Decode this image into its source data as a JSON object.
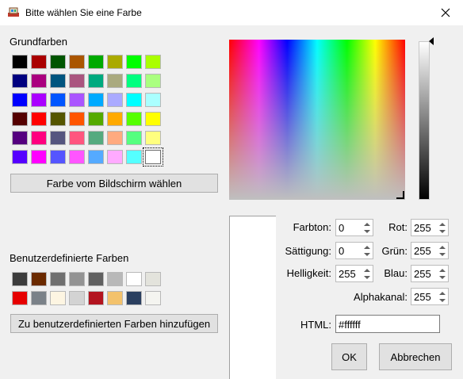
{
  "window": {
    "title": "Bitte wählen Sie eine Farbe"
  },
  "basic_colors": {
    "label": "Grundfarben",
    "rows": [
      [
        "#000000",
        "#aa0000",
        "#005500",
        "#aa5500",
        "#00aa00",
        "#aaaa00",
        "#00ff00",
        "#aaff00"
      ],
      [
        "#00007f",
        "#aa007f",
        "#00557f",
        "#aa557f",
        "#00aa7f",
        "#aaaa7f",
        "#00ff7f",
        "#aaff7f"
      ],
      [
        "#0000ff",
        "#aa00ff",
        "#0055ff",
        "#aa55ff",
        "#00aaff",
        "#aaaaff",
        "#00ffff",
        "#aaffff"
      ],
      [
        "#550000",
        "#ff0000",
        "#555500",
        "#ff5500",
        "#55aa00",
        "#ffaa00",
        "#55ff00",
        "#ffff00"
      ],
      [
        "#55007f",
        "#ff007f",
        "#55557f",
        "#ff557f",
        "#55aa7f",
        "#ffaa7f",
        "#55ff7f",
        "#ffff7f"
      ],
      [
        "#5500ff",
        "#ff00ff",
        "#5555ff",
        "#ff55ff",
        "#55aaff",
        "#ffaaff",
        "#55ffff",
        "#ffffff"
      ]
    ]
  },
  "pick_screen_button": "Farbe vom Bildschirm wählen",
  "custom_colors": {
    "label": "Benutzerdefinierte Farben",
    "rows": [
      [
        "#3c3c3c",
        "#6b2a00",
        "#6f6f6f",
        "#939393",
        "#606060",
        "#b8b8b8",
        "#ffffff",
        "#e3e3dc"
      ],
      [
        "#e60000",
        "#7a8188",
        "#fdf5e2",
        "#d3d3d3",
        "#b3141f",
        "#f3c26c",
        "#2a3f5f",
        "#f4f4f0"
      ]
    ]
  },
  "add_custom_button": "Zu benutzerdefinierten Farben hinzufügen",
  "fields": {
    "hue": {
      "label": "Farbton:",
      "value": "0"
    },
    "saturation": {
      "label": "Sättigung:",
      "value": "0"
    },
    "value": {
      "label": "Helligkeit:",
      "value": "255"
    },
    "red": {
      "label": "Rot:",
      "value": "255"
    },
    "green": {
      "label": "Grün:",
      "value": "255"
    },
    "blue": {
      "label": "Blau:",
      "value": "255"
    },
    "alpha": {
      "label": "Alphakanal:",
      "value": "255"
    },
    "html": {
      "label": "HTML:",
      "value": "#ffffff"
    }
  },
  "current_color": "#ffffff",
  "buttons": {
    "ok": "OK",
    "cancel": "Abbrechen"
  }
}
